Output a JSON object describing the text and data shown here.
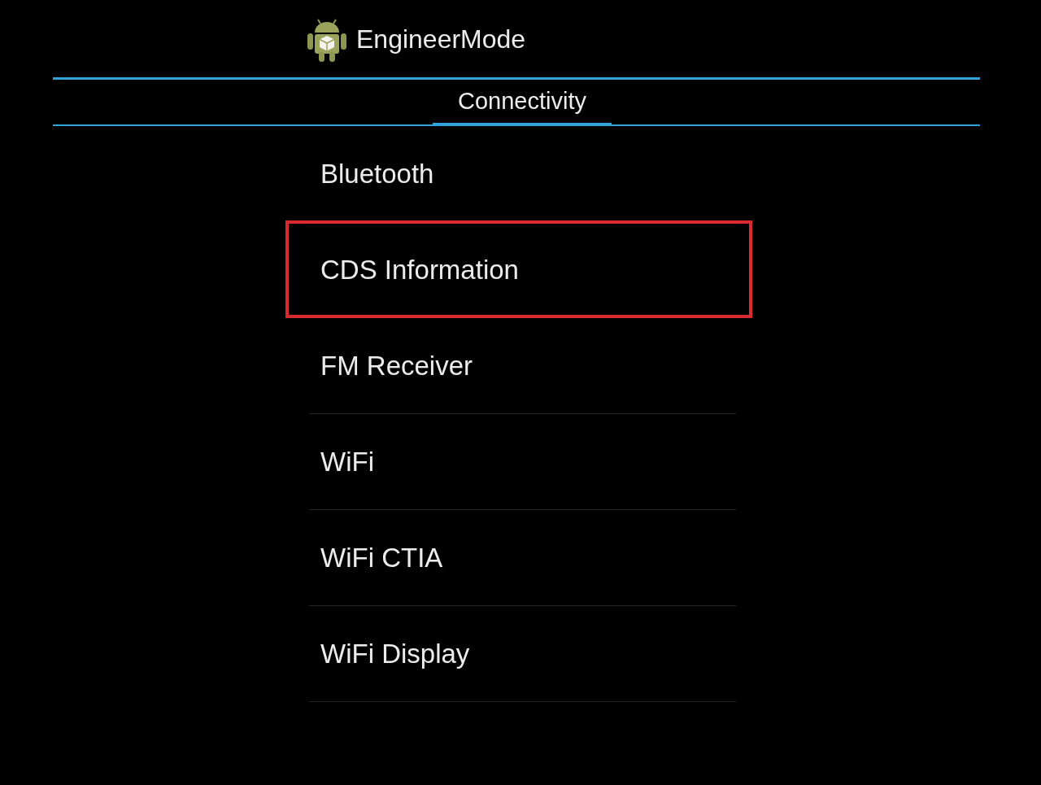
{
  "app_bar": {
    "title": "EngineerMode"
  },
  "tabs": [
    {
      "label": "Connectivity",
      "selected": true
    }
  ],
  "items": [
    {
      "label": "Bluetooth",
      "highlighted": false
    },
    {
      "label": "CDS Information",
      "highlighted": true
    },
    {
      "label": "FM Receiver",
      "highlighted": false
    },
    {
      "label": "WiFi",
      "highlighted": false
    },
    {
      "label": "WiFi CTIA",
      "highlighted": false
    },
    {
      "label": "WiFi Display",
      "highlighted": false
    }
  ]
}
